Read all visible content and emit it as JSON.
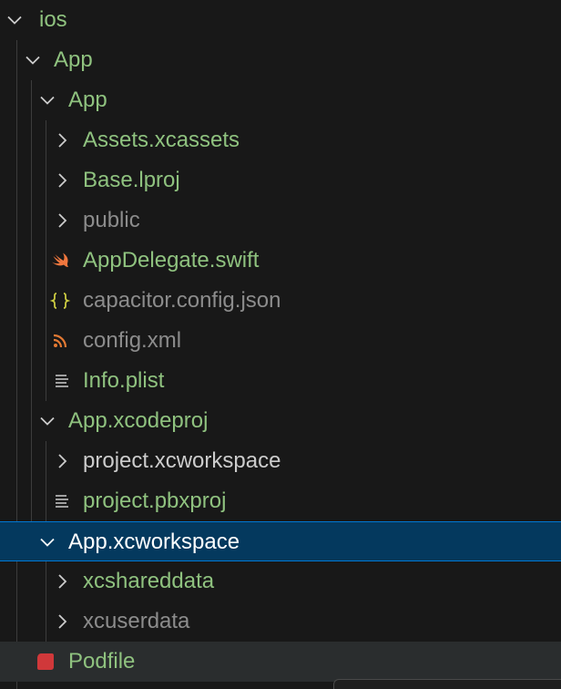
{
  "explorer": {
    "colors": {
      "background": "#181818",
      "folder_text": "#8fc27f",
      "muted_text": "#8c8c8c",
      "white_text": "#cccccc",
      "selected_bg": "#04395e",
      "selected_border": "#0078d4",
      "hover_bg": "#2a2d2e",
      "swift_icon": "#f0773e",
      "json_icon": "#cbcb41",
      "xml_icon": "#e37933",
      "ruby_icon": "#d0383a",
      "chevron": "#cccccc"
    },
    "items": [
      {
        "label": "ios",
        "twisty": "chevron-down-icon",
        "color": "#8fc27f"
      },
      {
        "label": "App",
        "twisty": "chevron-down-icon",
        "color": "#8fc27f"
      },
      {
        "label": "App",
        "twisty": "chevron-down-icon",
        "color": "#8fc27f"
      },
      {
        "label": "Assets.xcassets",
        "twisty": "chevron-right-icon",
        "color": "#8fc27f"
      },
      {
        "label": "Base.lproj",
        "twisty": "chevron-right-icon",
        "color": "#8fc27f"
      },
      {
        "label": "public",
        "twisty": "chevron-right-icon",
        "color": "#8c8c8c"
      },
      {
        "label": "AppDelegate.swift",
        "icon": "swift-file-icon",
        "color": "#8fc27f"
      },
      {
        "label": "capacitor.config.json",
        "icon": "json-file-icon",
        "color": "#8c8c8c"
      },
      {
        "label": "config.xml",
        "icon": "xml-rss-file-icon",
        "color": "#8c8c8c"
      },
      {
        "label": "Info.plist",
        "icon": "plist-lines-icon",
        "color": "#8fc27f"
      },
      {
        "label": "App.xcodeproj",
        "twisty": "chevron-down-icon",
        "color": "#8fc27f"
      },
      {
        "label": "project.xcworkspace",
        "twisty": "chevron-right-icon",
        "color": "#cccccc"
      },
      {
        "label": "project.pbxproj",
        "icon": "plist-lines-icon",
        "color": "#8fc27f"
      },
      {
        "label": "App.xcworkspace",
        "twisty": "chevron-down-icon",
        "color": "#ffffff",
        "selected": true
      },
      {
        "label": "xcshareddata",
        "twisty": "chevron-right-icon",
        "color": "#8fc27f"
      },
      {
        "label": "xcuserdata",
        "twisty": "chevron-right-icon",
        "color": "#8c8c8c"
      },
      {
        "label": "Podfile",
        "icon": "ruby-file-icon",
        "color": "#8fc27f",
        "hover": true
      }
    ]
  }
}
